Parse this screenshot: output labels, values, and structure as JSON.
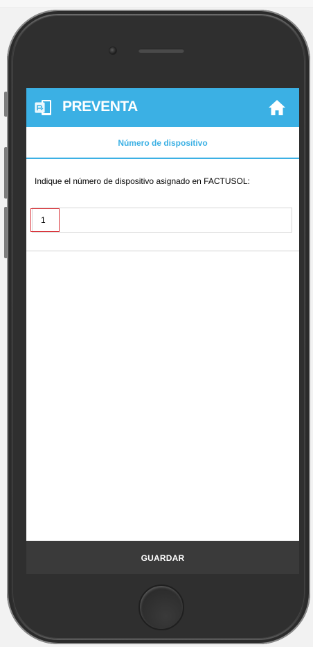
{
  "app": {
    "title": "PREVENTA",
    "logo_icon": "preventa-logo-icon",
    "home_icon": "home-icon"
  },
  "subheader": {
    "title": "Número de dispositivo"
  },
  "form": {
    "prompt": "Indique el número de dispositivo asignado en FACTUSOL:",
    "device_number": "1"
  },
  "actions": {
    "save_label": "GUARDAR"
  },
  "colors": {
    "accent": "#3bb0e4",
    "save_bar": "#3a3a3a",
    "focus_highlight": "#d9343a"
  }
}
